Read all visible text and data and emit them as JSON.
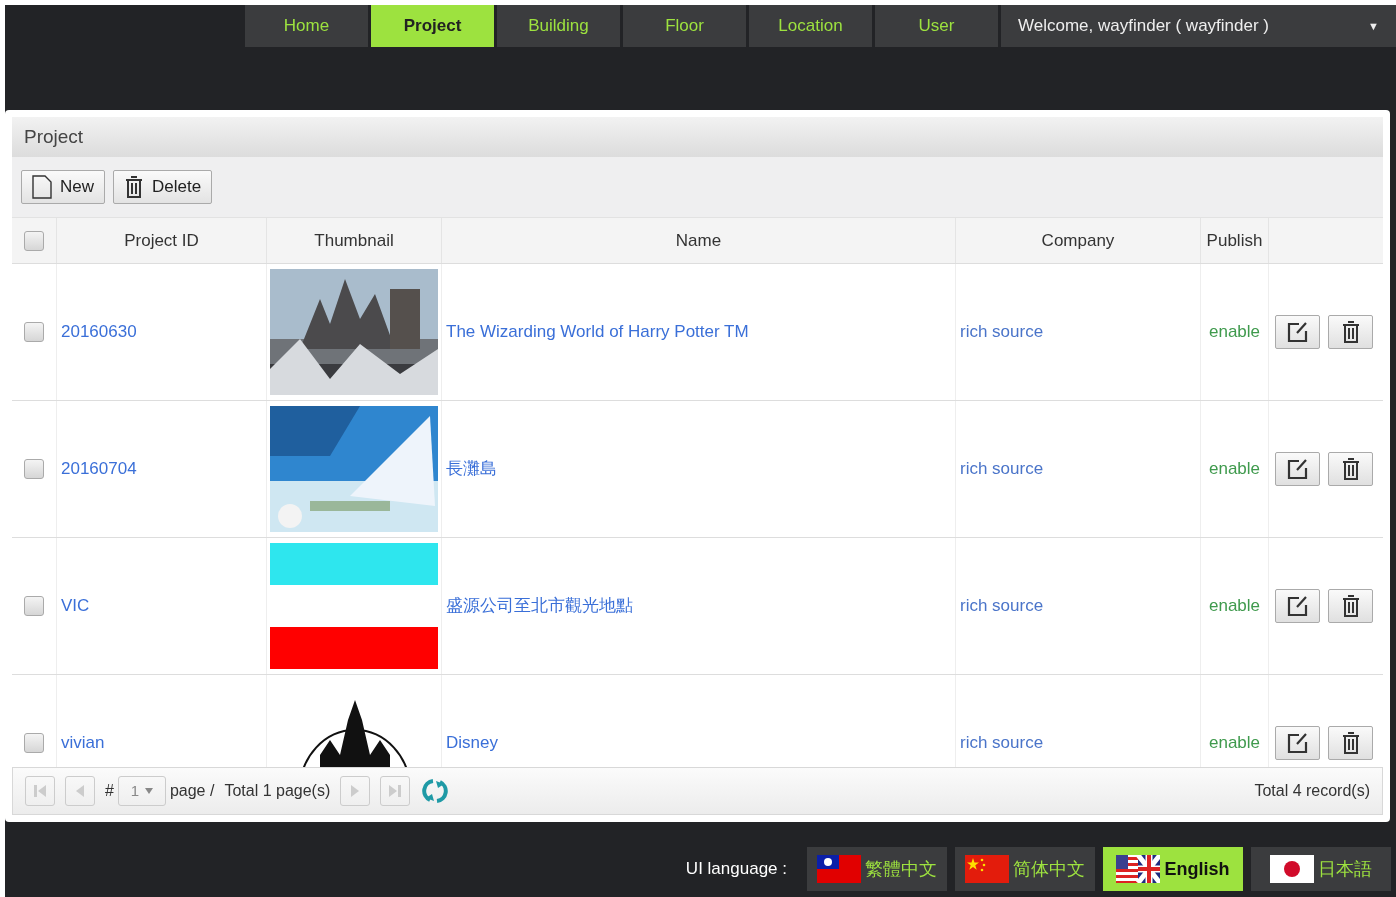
{
  "nav": {
    "tabs": [
      {
        "label": "Home",
        "selected": false
      },
      {
        "label": "Project",
        "selected": true
      },
      {
        "label": "Building",
        "selected": false
      },
      {
        "label": "Floor",
        "selected": false
      },
      {
        "label": "Location",
        "selected": false
      },
      {
        "label": "User",
        "selected": false
      }
    ],
    "user_menu": {
      "label": "Welcome, wayfinder ( wayfinder )",
      "caret": "▼"
    }
  },
  "panel": {
    "title": "Project",
    "toolbar": [
      {
        "label": "New",
        "kind": "new"
      },
      {
        "label": "Delete",
        "kind": "delete"
      }
    ],
    "table": {
      "select_all": {
        "checked": false
      },
      "columns": [
        "Project ID",
        "Thumbnail",
        "Name",
        "Company",
        "Publish"
      ],
      "rows": [
        {
          "checked": false,
          "project_id": "20160630",
          "name": "The Wizarding World of Harry Potter TM",
          "company": "rich source",
          "publish": "enable"
        },
        {
          "checked": false,
          "project_id": "20160704",
          "name": "長灘島",
          "company": "rich source",
          "publish": "enable"
        },
        {
          "checked": false,
          "project_id": "VIC",
          "name": "盛源公司至北市觀光地點",
          "company": "rich source",
          "publish": "enable"
        },
        {
          "checked": false,
          "project_id": "vivian",
          "name": "Disney",
          "company": "rich source",
          "publish": "enable"
        }
      ]
    },
    "pager": {
      "hash": "#",
      "page": "1",
      "page_label": "page /",
      "total_pages": "Total 1 page(s)",
      "total_records": "Total 4 record(s)"
    }
  },
  "footer": {
    "label": "UI language :",
    "languages": [
      {
        "label": "繁體中文",
        "kind": "tw",
        "selected": false
      },
      {
        "label": "简体中文",
        "kind": "cn",
        "selected": false
      },
      {
        "label": "English",
        "kind": "us_uk",
        "selected": true
      },
      {
        "label": "日本語",
        "kind": "jp",
        "selected": false
      }
    ]
  }
}
